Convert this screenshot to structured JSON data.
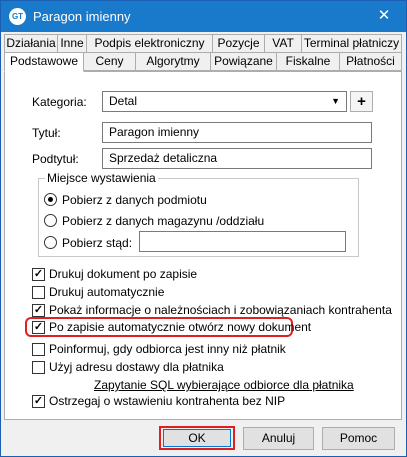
{
  "window": {
    "title": "Paragon imienny",
    "icon_text": "GT"
  },
  "tabs_row1": [
    {
      "label": "Działania"
    },
    {
      "label": "Inne"
    },
    {
      "label": "Podpis elektroniczny"
    },
    {
      "label": "Pozycje"
    },
    {
      "label": "VAT"
    },
    {
      "label": "Terminal płatniczy"
    }
  ],
  "tabs_row2": [
    {
      "label": "Podstawowe",
      "active": true
    },
    {
      "label": "Ceny"
    },
    {
      "label": "Algorytmy"
    },
    {
      "label": "Powiązane"
    },
    {
      "label": "Fiskalne"
    },
    {
      "label": "Płatności"
    }
  ],
  "form": {
    "kategoria_label": "Kategoria:",
    "kategoria_value": "Detal",
    "plus_label": "+",
    "tytul_label": "Tytuł:",
    "tytul_value": "Paragon imienny",
    "podtytul_label": "Podtytuł:",
    "podtytul_value": "Sprzedaż detaliczna"
  },
  "issue_place": {
    "title": "Miejsce wystawienia",
    "options": [
      {
        "label": "Pobierz z danych podmiotu",
        "checked": true
      },
      {
        "label": "Pobierz z danych magazynu /oddziału",
        "checked": false
      },
      {
        "label": "Pobierz stąd:",
        "checked": false
      }
    ],
    "custom_value": ""
  },
  "checkboxes": [
    {
      "label": "Drukuj dokument po zapisie",
      "checked": true
    },
    {
      "label": "Drukuj automatycznie",
      "checked": false
    },
    {
      "label": "Pokaż informacje o należnościach i zobowiązaniach kontrahenta",
      "checked": true
    },
    {
      "label": "Po zapisie automatycznie otwórz nowy dokument",
      "checked": true
    },
    {
      "label": "Poinformuj, gdy odbiorca jest inny niż płatnik",
      "checked": false
    },
    {
      "label": "Użyj adresu dostawy dla płatnika",
      "checked": false
    }
  ],
  "sql_link": "Zapytanie SQL wybierające odbiorce dla płatnika",
  "last_checkbox": {
    "label": "Ostrzegaj o wstawieniu kontrahenta bez NIP",
    "checked": true
  },
  "buttons": {
    "ok": "OK",
    "cancel": "Anuluj",
    "help": "Pomoc"
  },
  "colors": {
    "titlebar": "#1979ca",
    "highlight": "#e02020"
  }
}
